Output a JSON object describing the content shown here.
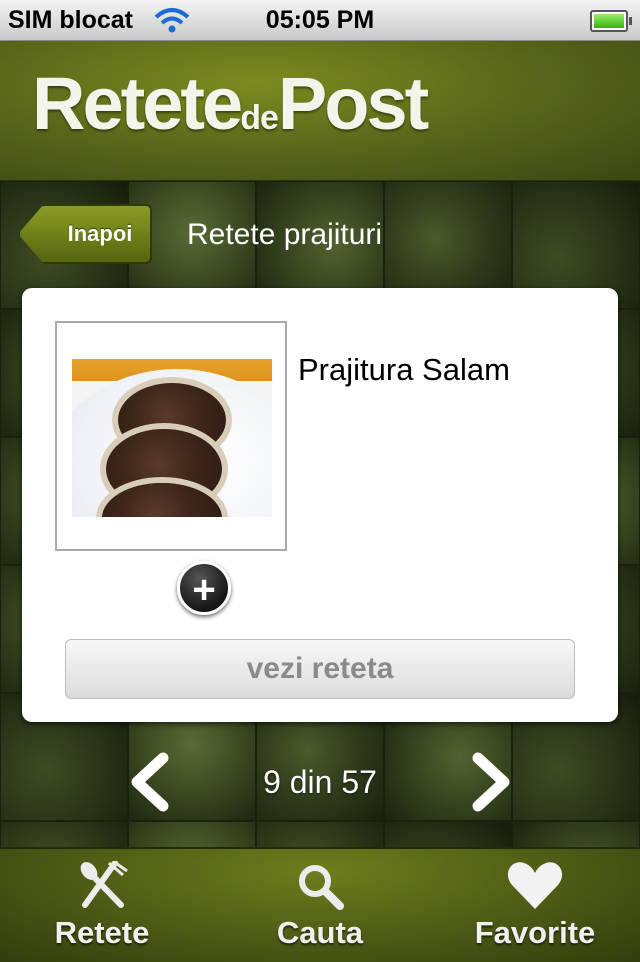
{
  "status_bar": {
    "carrier": "SIM blocat",
    "time": "05:05 PM",
    "battery_level": 1.0
  },
  "header": {
    "logo_part1": "Retete",
    "logo_part2": "de",
    "logo_part3": "Post"
  },
  "nav": {
    "back_label": "Inapoi",
    "title": "Retete prajituri"
  },
  "recipe": {
    "name": "Prajitura Salam",
    "add_favorite_symbol": "+",
    "view_button": "vezi reteta"
  },
  "pager": {
    "text": "9 din 57"
  },
  "tabs": [
    {
      "label": "Retete",
      "icon": "utensils-icon"
    },
    {
      "label": "Cauta",
      "icon": "search-icon"
    },
    {
      "label": "Favorite",
      "icon": "heart-icon"
    }
  ],
  "colors": {
    "accent_green": "#56631a",
    "card_bg": "#ffffff"
  }
}
